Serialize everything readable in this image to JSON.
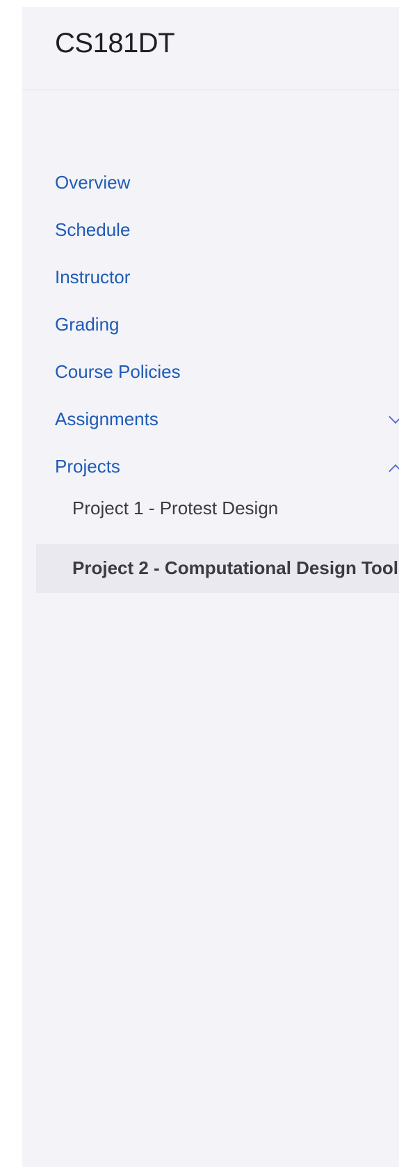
{
  "header": {
    "title": "CS181DT"
  },
  "nav": {
    "items": [
      {
        "label": "Overview"
      },
      {
        "label": "Schedule"
      },
      {
        "label": "Instructor"
      },
      {
        "label": "Grading"
      },
      {
        "label": "Course Policies"
      },
      {
        "label": "Assignments",
        "expanded": false
      },
      {
        "label": "Projects",
        "expanded": true
      }
    ],
    "projects": [
      {
        "label": "Project 1 - Protest Design"
      },
      {
        "label": "Project 2 - Computational Design Tool",
        "active": true
      }
    ]
  },
  "colors": {
    "link": "#1f5bb5",
    "sidebar_bg": "#f3f3f8",
    "active_bg": "#e9e9ef",
    "chevron": "#5a6fd6"
  },
  "icons": {
    "assignments_toggle": "chevron-down-icon",
    "projects_toggle": "chevron-up-icon"
  }
}
